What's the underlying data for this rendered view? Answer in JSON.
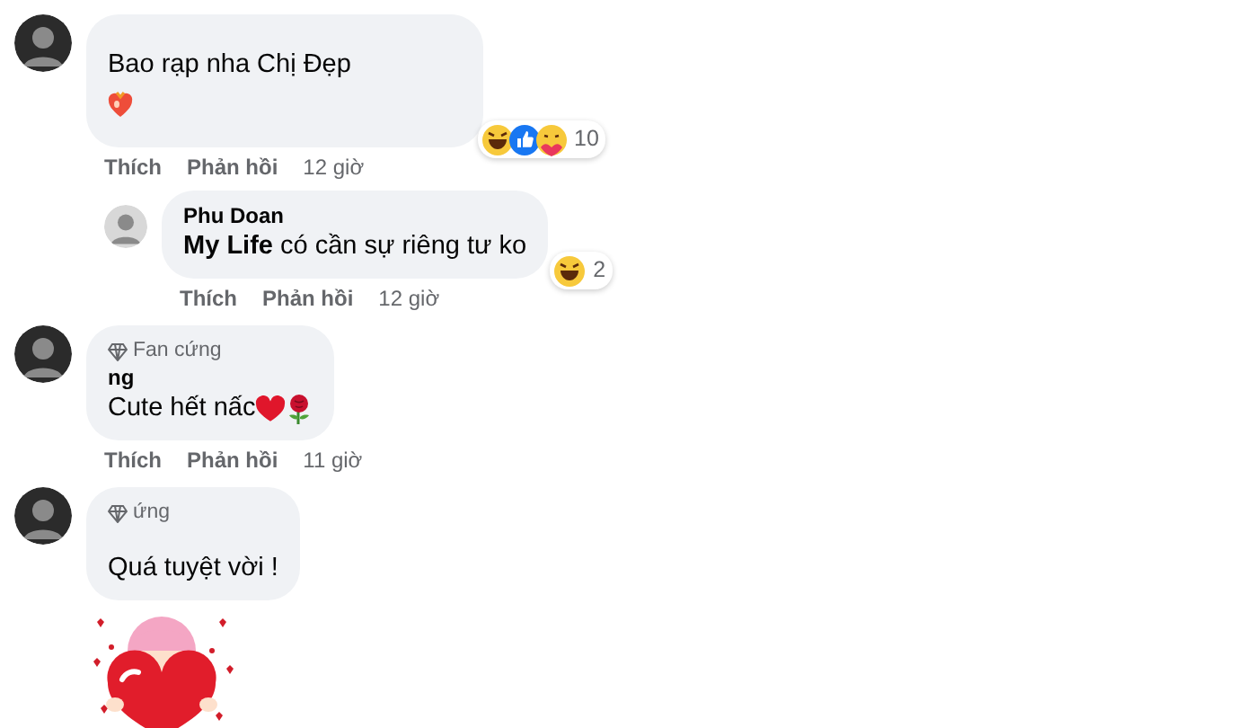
{
  "comments": [
    {
      "kind": "comment",
      "text": "Bao rạp nha Chị Đẹp",
      "sticker": {
        "kind": "heart-emoji"
      },
      "reactions": {
        "icons": [
          {
            "kind": "haha"
          },
          {
            "kind": "like"
          },
          {
            "kind": "care"
          }
        ],
        "count": "10"
      },
      "actions": [
        "Thích",
        "Phản hồi"
      ],
      "time": "12 giờ"
    },
    {
      "kind": "reply",
      "name": "Phu Doan",
      "text": "**My** **Life** có cần sự riêng tư ko",
      "reactions": {
        "icons": [
          {
            "kind": "haha"
          }
        ],
        "count": "2"
      },
      "actions": [
        "Thích",
        "Phản hồi"
      ],
      "time": "12 giờ"
    },
    {
      "kind": "comment",
      "name": "ng",
      "badge": "Fan cứng",
      "text": "Cute hết nấc",
      "text_icons": [
        {
          "kind": "heart"
        },
        {
          "kind": "rose"
        }
      ],
      "actions": [
        "Thích",
        "Phản hồi"
      ],
      "time": "11 giờ"
    },
    {
      "kind": "comment",
      "badge": "ứng",
      "text": "Quá tuyệt vời !",
      "sticker": {
        "kind": "heart-hug"
      }
    }
  ]
}
